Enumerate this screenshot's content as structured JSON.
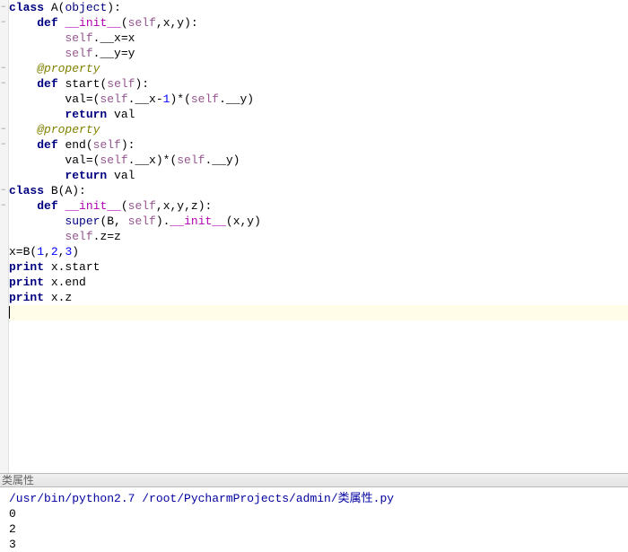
{
  "editor": {
    "tokens": [
      [
        [
          "kw",
          "class"
        ],
        [
          "punc",
          " "
        ],
        [
          "ident",
          "A"
        ],
        [
          "punc",
          "("
        ],
        [
          "builtin",
          "object"
        ],
        [
          "punc",
          "):"
        ]
      ],
      [
        [
          "punc",
          "    "
        ],
        [
          "kw",
          "def"
        ],
        [
          "punc",
          " "
        ],
        [
          "magic",
          "__init__"
        ],
        [
          "punc",
          "("
        ],
        [
          "self",
          "self"
        ],
        [
          "punc",
          ",x,y):"
        ]
      ],
      [
        [
          "punc",
          "        "
        ],
        [
          "self",
          "self"
        ],
        [
          "punc",
          ".__x=x"
        ]
      ],
      [
        [
          "punc",
          "        "
        ],
        [
          "self",
          "self"
        ],
        [
          "punc",
          ".__y=y"
        ]
      ],
      [
        [
          "punc",
          "    "
        ],
        [
          "decorator",
          "@property"
        ]
      ],
      [
        [
          "punc",
          "    "
        ],
        [
          "kw",
          "def"
        ],
        [
          "punc",
          " "
        ],
        [
          "ident",
          "start"
        ],
        [
          "punc",
          "("
        ],
        [
          "self",
          "self"
        ],
        [
          "punc",
          "):"
        ]
      ],
      [
        [
          "punc",
          "        val=("
        ],
        [
          "self",
          "self"
        ],
        [
          "punc",
          ".__x-"
        ],
        [
          "num",
          "1"
        ],
        [
          "punc",
          ")*("
        ],
        [
          "self",
          "self"
        ],
        [
          "punc",
          ".__y)"
        ]
      ],
      [
        [
          "punc",
          "        "
        ],
        [
          "kw",
          "return"
        ],
        [
          "punc",
          " val"
        ]
      ],
      [
        [
          "punc",
          "    "
        ],
        [
          "decorator",
          "@property"
        ]
      ],
      [
        [
          "punc",
          "    "
        ],
        [
          "kw",
          "def"
        ],
        [
          "punc",
          " "
        ],
        [
          "ident",
          "end"
        ],
        [
          "punc",
          "("
        ],
        [
          "self",
          "self"
        ],
        [
          "punc",
          "):"
        ]
      ],
      [
        [
          "punc",
          "        val=("
        ],
        [
          "self",
          "self"
        ],
        [
          "punc",
          ".__x)*("
        ],
        [
          "self",
          "self"
        ],
        [
          "punc",
          ".__y)"
        ]
      ],
      [
        [
          "punc",
          "        "
        ],
        [
          "kw",
          "return"
        ],
        [
          "punc",
          " val"
        ]
      ],
      [
        [
          "kw",
          "class"
        ],
        [
          "punc",
          " "
        ],
        [
          "ident",
          "B"
        ],
        [
          "punc",
          "(A):"
        ]
      ],
      [
        [
          "punc",
          "    "
        ],
        [
          "kw",
          "def"
        ],
        [
          "punc",
          " "
        ],
        [
          "magic",
          "__init__"
        ],
        [
          "punc",
          "("
        ],
        [
          "self",
          "self"
        ],
        [
          "punc",
          ",x,y,z):"
        ]
      ],
      [
        [
          "punc",
          "        "
        ],
        [
          "builtin",
          "super"
        ],
        [
          "punc",
          "(B, "
        ],
        [
          "self",
          "self"
        ],
        [
          "punc",
          ")."
        ],
        [
          "magic",
          "__init__"
        ],
        [
          "punc",
          "(x,y)"
        ]
      ],
      [
        [
          "punc",
          "        "
        ],
        [
          "self",
          "self"
        ],
        [
          "punc",
          ".z=z"
        ]
      ],
      [
        [
          "ident",
          "x=B("
        ],
        [
          "num",
          "1"
        ],
        [
          "punc",
          ","
        ],
        [
          "num",
          "2"
        ],
        [
          "punc",
          ","
        ],
        [
          "num",
          "3"
        ],
        [
          "punc",
          ")"
        ]
      ],
      [
        [
          "kw",
          "print"
        ],
        [
          "punc",
          " x.start"
        ]
      ],
      [
        [
          "kw",
          "print"
        ],
        [
          "punc",
          " x.end"
        ]
      ],
      [
        [
          "kw",
          "print"
        ],
        [
          "punc",
          " x.z"
        ]
      ]
    ],
    "fold_lines": [
      0,
      1,
      4,
      5,
      8,
      9,
      12,
      13
    ],
    "current_line_index": 20
  },
  "panel": {
    "label": "类属性"
  },
  "console": {
    "command": "/usr/bin/python2.7 /root/PycharmProjects/admin/类属性.py",
    "output": [
      "0",
      "2",
      "3"
    ]
  }
}
